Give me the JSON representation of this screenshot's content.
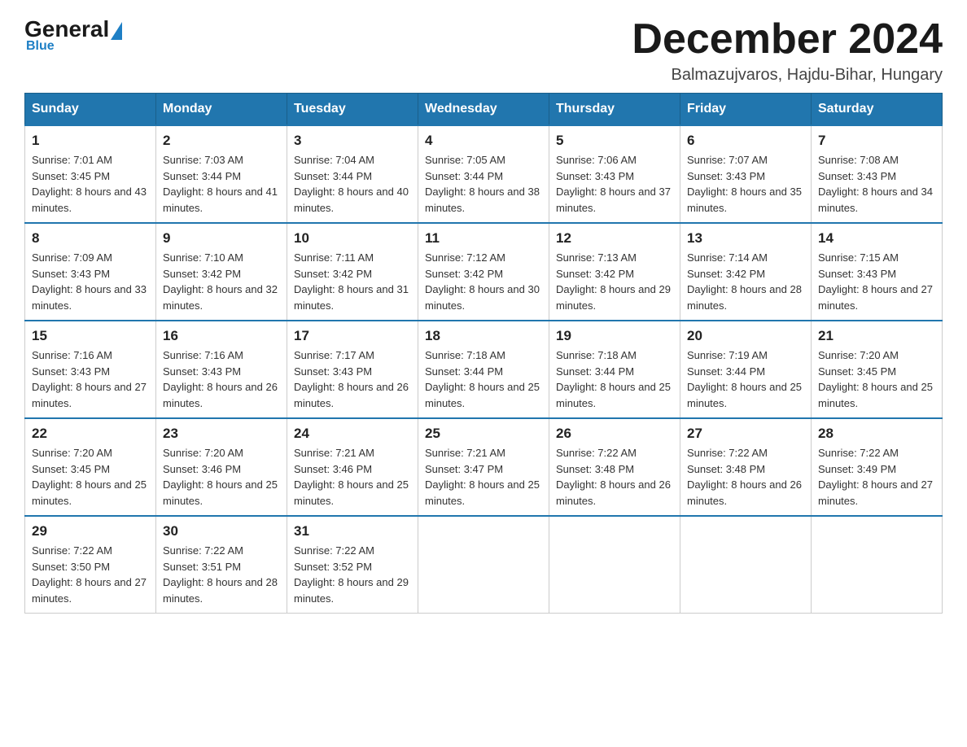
{
  "header": {
    "logo": {
      "general": "General",
      "blue": "Blue"
    },
    "title": "December 2024",
    "location": "Balmazujvaros, Hajdu-Bihar, Hungary"
  },
  "calendar": {
    "days_of_week": [
      "Sunday",
      "Monday",
      "Tuesday",
      "Wednesday",
      "Thursday",
      "Friday",
      "Saturday"
    ],
    "weeks": [
      [
        {
          "day": "1",
          "sunrise": "7:01 AM",
          "sunset": "3:45 PM",
          "daylight": "8 hours and 43 minutes."
        },
        {
          "day": "2",
          "sunrise": "7:03 AM",
          "sunset": "3:44 PM",
          "daylight": "8 hours and 41 minutes."
        },
        {
          "day": "3",
          "sunrise": "7:04 AM",
          "sunset": "3:44 PM",
          "daylight": "8 hours and 40 minutes."
        },
        {
          "day": "4",
          "sunrise": "7:05 AM",
          "sunset": "3:44 PM",
          "daylight": "8 hours and 38 minutes."
        },
        {
          "day": "5",
          "sunrise": "7:06 AM",
          "sunset": "3:43 PM",
          "daylight": "8 hours and 37 minutes."
        },
        {
          "day": "6",
          "sunrise": "7:07 AM",
          "sunset": "3:43 PM",
          "daylight": "8 hours and 35 minutes."
        },
        {
          "day": "7",
          "sunrise": "7:08 AM",
          "sunset": "3:43 PM",
          "daylight": "8 hours and 34 minutes."
        }
      ],
      [
        {
          "day": "8",
          "sunrise": "7:09 AM",
          "sunset": "3:43 PM",
          "daylight": "8 hours and 33 minutes."
        },
        {
          "day": "9",
          "sunrise": "7:10 AM",
          "sunset": "3:42 PM",
          "daylight": "8 hours and 32 minutes."
        },
        {
          "day": "10",
          "sunrise": "7:11 AM",
          "sunset": "3:42 PM",
          "daylight": "8 hours and 31 minutes."
        },
        {
          "day": "11",
          "sunrise": "7:12 AM",
          "sunset": "3:42 PM",
          "daylight": "8 hours and 30 minutes."
        },
        {
          "day": "12",
          "sunrise": "7:13 AM",
          "sunset": "3:42 PM",
          "daylight": "8 hours and 29 minutes."
        },
        {
          "day": "13",
          "sunrise": "7:14 AM",
          "sunset": "3:42 PM",
          "daylight": "8 hours and 28 minutes."
        },
        {
          "day": "14",
          "sunrise": "7:15 AM",
          "sunset": "3:43 PM",
          "daylight": "8 hours and 27 minutes."
        }
      ],
      [
        {
          "day": "15",
          "sunrise": "7:16 AM",
          "sunset": "3:43 PM",
          "daylight": "8 hours and 27 minutes."
        },
        {
          "day": "16",
          "sunrise": "7:16 AM",
          "sunset": "3:43 PM",
          "daylight": "8 hours and 26 minutes."
        },
        {
          "day": "17",
          "sunrise": "7:17 AM",
          "sunset": "3:43 PM",
          "daylight": "8 hours and 26 minutes."
        },
        {
          "day": "18",
          "sunrise": "7:18 AM",
          "sunset": "3:44 PM",
          "daylight": "8 hours and 25 minutes."
        },
        {
          "day": "19",
          "sunrise": "7:18 AM",
          "sunset": "3:44 PM",
          "daylight": "8 hours and 25 minutes."
        },
        {
          "day": "20",
          "sunrise": "7:19 AM",
          "sunset": "3:44 PM",
          "daylight": "8 hours and 25 minutes."
        },
        {
          "day": "21",
          "sunrise": "7:20 AM",
          "sunset": "3:45 PM",
          "daylight": "8 hours and 25 minutes."
        }
      ],
      [
        {
          "day": "22",
          "sunrise": "7:20 AM",
          "sunset": "3:45 PM",
          "daylight": "8 hours and 25 minutes."
        },
        {
          "day": "23",
          "sunrise": "7:20 AM",
          "sunset": "3:46 PM",
          "daylight": "8 hours and 25 minutes."
        },
        {
          "day": "24",
          "sunrise": "7:21 AM",
          "sunset": "3:46 PM",
          "daylight": "8 hours and 25 minutes."
        },
        {
          "day": "25",
          "sunrise": "7:21 AM",
          "sunset": "3:47 PM",
          "daylight": "8 hours and 25 minutes."
        },
        {
          "day": "26",
          "sunrise": "7:22 AM",
          "sunset": "3:48 PM",
          "daylight": "8 hours and 26 minutes."
        },
        {
          "day": "27",
          "sunrise": "7:22 AM",
          "sunset": "3:48 PM",
          "daylight": "8 hours and 26 minutes."
        },
        {
          "day": "28",
          "sunrise": "7:22 AM",
          "sunset": "3:49 PM",
          "daylight": "8 hours and 27 minutes."
        }
      ],
      [
        {
          "day": "29",
          "sunrise": "7:22 AM",
          "sunset": "3:50 PM",
          "daylight": "8 hours and 27 minutes."
        },
        {
          "day": "30",
          "sunrise": "7:22 AM",
          "sunset": "3:51 PM",
          "daylight": "8 hours and 28 minutes."
        },
        {
          "day": "31",
          "sunrise": "7:22 AM",
          "sunset": "3:52 PM",
          "daylight": "8 hours and 29 minutes."
        },
        null,
        null,
        null,
        null
      ]
    ]
  }
}
